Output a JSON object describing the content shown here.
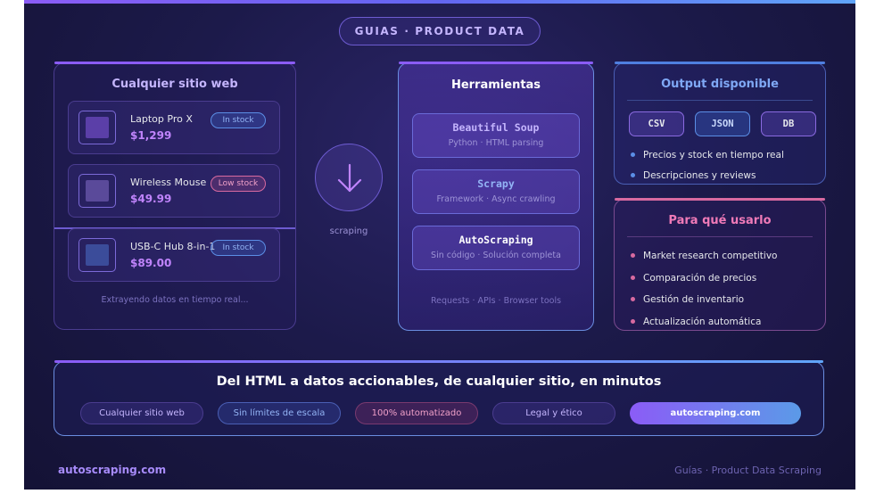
{
  "header": {
    "pill": "GUIAS · PRODUCT DATA"
  },
  "left": {
    "title": "Cualquier sitio web",
    "products": [
      {
        "name": "Laptop Pro X",
        "price": "$1,299",
        "status": "In stock"
      },
      {
        "name": "Wireless Mouse",
        "price": "$49.99",
        "status": "Low stock"
      },
      {
        "name": "USB-C Hub 8-in-1",
        "price": "$89.00",
        "status": "In stock"
      }
    ],
    "footnote": "Extrayendo datos en tiempo real..."
  },
  "arrow": {
    "label": "scraping"
  },
  "tools": {
    "title": "Herramientas",
    "items": [
      {
        "name": "Beautiful Soup",
        "desc": "Python · HTML parsing"
      },
      {
        "name": "Scrapy",
        "desc": "Framework · Async crawling"
      },
      {
        "name": "AutoScraping",
        "desc": "Sin código · Solución completa"
      }
    ],
    "footnote": "Requests · APIs · Browser tools"
  },
  "output": {
    "title": "Output disponible",
    "formats": [
      "CSV",
      "JSON",
      "DB"
    ],
    "bullets": [
      "Precios y stock en tiempo real",
      "Descripciones y reviews"
    ]
  },
  "uses": {
    "title": "Para qué usarlo",
    "bullets": [
      "Market research competitivo",
      "Comparación de precios",
      "Gestión de inventario",
      "Actualización automática"
    ]
  },
  "bottom": {
    "headline": "Del HTML a datos accionables, de cualquier sitio, en minutos",
    "tags": [
      "Cualquier sitio web",
      "Sin límites de escala",
      "100% automatizado",
      "Legal y ético",
      "autoscraping.com"
    ]
  },
  "footer": {
    "left": "autoscraping.com",
    "right": "Guías · Product Data Scraping"
  },
  "colors": {
    "accent_purple": "#8b5cf6",
    "accent_blue": "#60a5fa",
    "accent_pink": "#d86aa0",
    "background": "#1c1a4a"
  }
}
